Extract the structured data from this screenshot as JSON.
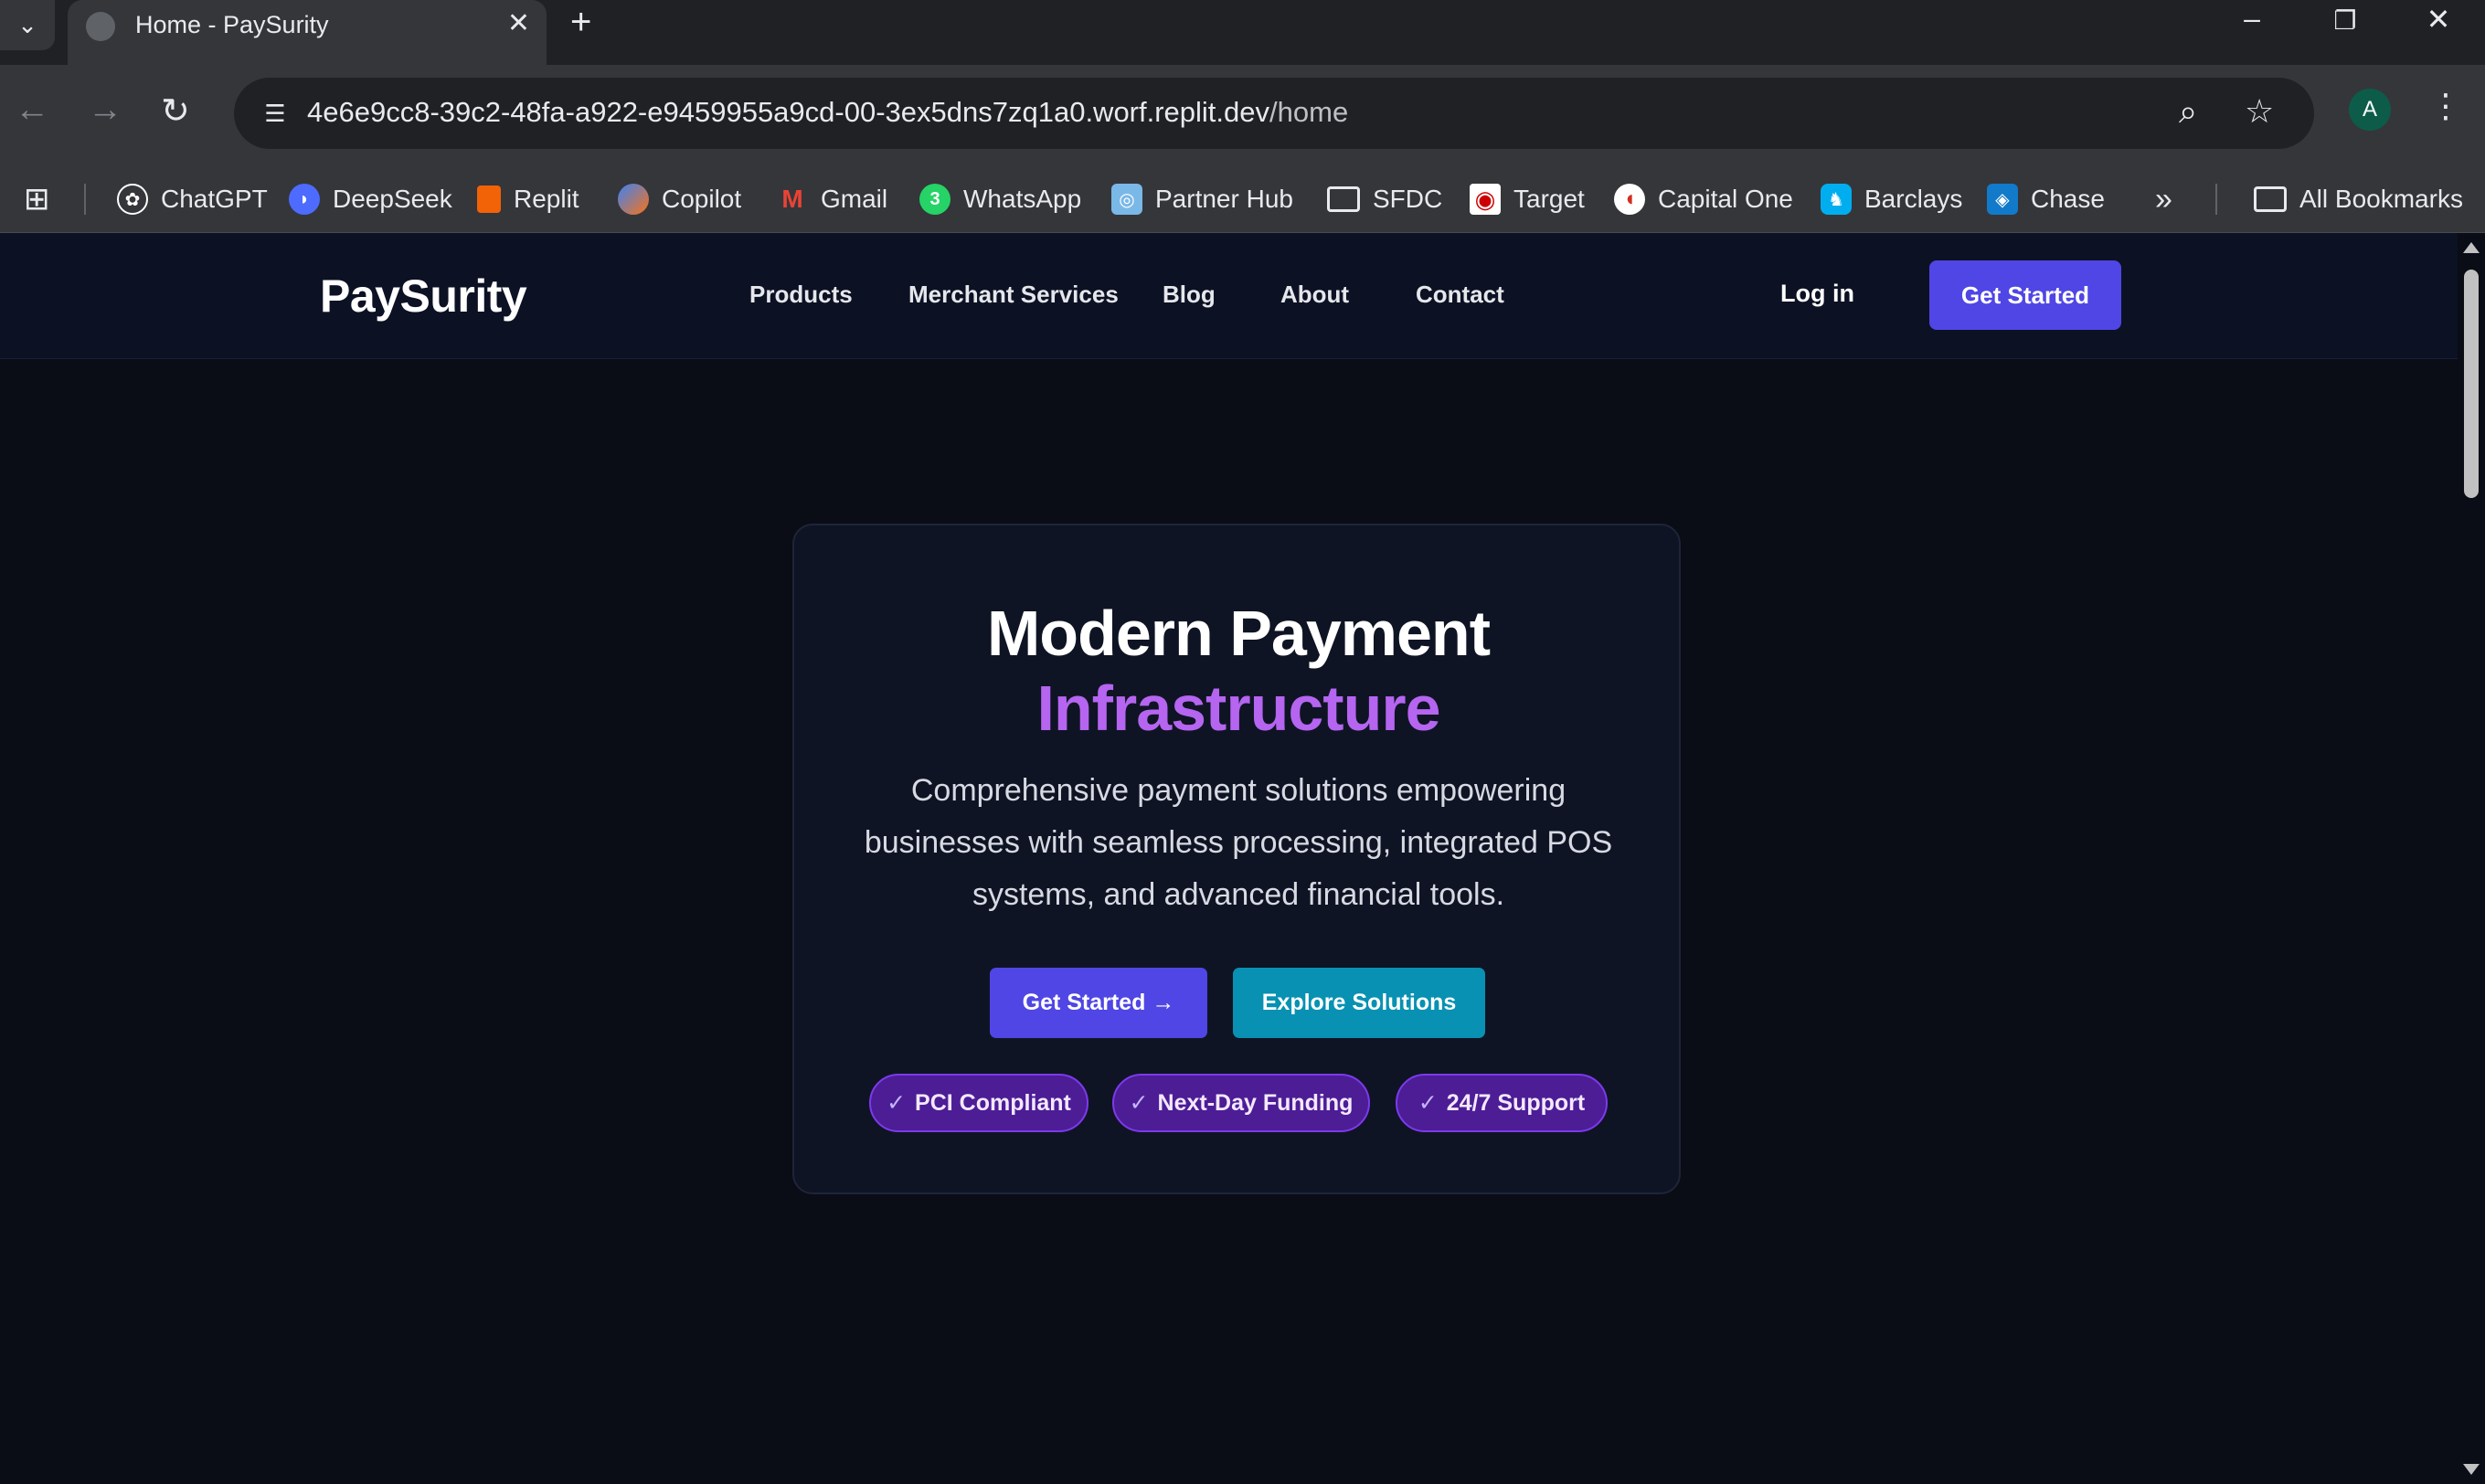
{
  "browser": {
    "tab_title": "Home - PaySurity",
    "url_host": "4e6e9cc8-39c2-48fa-a922-e9459955a9cd-00-3ex5dns7zq1a0.worf.replit.dev",
    "url_path": "/home",
    "profile_initial": "A",
    "icons": {
      "tab_search": "chevron-down-icon",
      "close_tab": "close-icon",
      "new_tab": "plus-icon",
      "back": "arrow-left-icon",
      "forward": "arrow-right-icon",
      "reload": "reload-icon",
      "zoom": "zoom-icon",
      "bookmark_star": "star-icon",
      "menu": "kebab-menu-icon"
    },
    "bookmarks": [
      {
        "label": "ChatGPT",
        "icon": "chatgpt-icon",
        "color": "#ffffff"
      },
      {
        "label": "DeepSeek",
        "icon": "deepseek-icon",
        "color": "#4d6bfe"
      },
      {
        "label": "Replit",
        "icon": "replit-icon",
        "color": "#f26207"
      },
      {
        "label": "Copilot",
        "icon": "copilot-icon",
        "color": "#3b82f6"
      },
      {
        "label": "Gmail",
        "icon": "gmail-icon",
        "color": "#ea4335"
      },
      {
        "label": "WhatsApp",
        "icon": "whatsapp-icon",
        "color": "#25d366"
      },
      {
        "label": "Partner Hub",
        "icon": "partner-hub-icon",
        "color": "#7ab8e8"
      },
      {
        "label": "SFDC",
        "icon": "folder-icon",
        "color": "#e8eaed"
      },
      {
        "label": "Target",
        "icon": "target-icon",
        "color": "#cc0000"
      },
      {
        "label": "Capital One",
        "icon": "capital-one-icon",
        "color": "#d22e1e"
      },
      {
        "label": "Barclays",
        "icon": "barclays-icon",
        "color": "#00aeef"
      },
      {
        "label": "Chase",
        "icon": "chase-icon",
        "color": "#117aca"
      }
    ],
    "all_bookmarks_label": "All Bookmarks"
  },
  "site": {
    "logo": "PaySurity",
    "nav": [
      "Products",
      "Merchant Services",
      "Blog",
      "About",
      "Contact"
    ],
    "login_label": "Log in",
    "header_cta": "Get Started",
    "accent_color": "#4f46e5",
    "secondary_color": "#0891b2",
    "highlight_color": "#b565f0"
  },
  "hero": {
    "title_line1": "Modern Payment",
    "title_line2": "Infrastructure",
    "description": "Comprehensive payment solutions empowering businesses with seamless processing, integrated POS systems, and advanced financial tools.",
    "primary_button": "Get Started →",
    "secondary_button": "Explore Solutions",
    "badges": [
      {
        "check": "✓",
        "label": "PCI Compliant"
      },
      {
        "check": "✓",
        "label": "Next-Day Funding"
      },
      {
        "check": "✓",
        "label": "24/7 Support"
      }
    ]
  }
}
